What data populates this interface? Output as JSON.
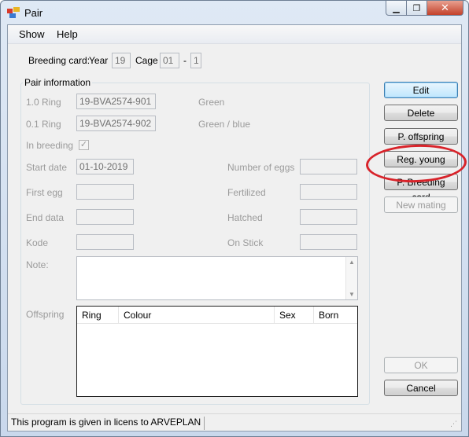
{
  "window": {
    "title": "Pair",
    "minimize_glyph": "▁",
    "maximize_glyph": "❐",
    "close_glyph": "✕"
  },
  "menu": {
    "items": [
      "Show",
      "Help"
    ]
  },
  "breeding_card": {
    "label": "Breeding card:",
    "year_label": "Year",
    "year_value": "19",
    "cage_label": "Cage",
    "cage_value": "01",
    "separator": "-",
    "cage_sub_value": "1"
  },
  "pair_info": {
    "group_title": "Pair information",
    "ring_10_label": "1.0 Ring",
    "ring_10_value": "19-BVA2574-901",
    "ring_10_colour": "Green",
    "ring_01_label": "0.1 Ring",
    "ring_01_value": "19-BVA2574-902",
    "ring_01_colour": "Green / blue",
    "in_breeding_label": "In breeding",
    "in_breeding_checked": true,
    "in_breeding_mark": "✓",
    "start_date_label": "Start date",
    "start_date_value": "01-10-2019",
    "first_egg_label": "First egg",
    "first_egg_value": "",
    "end_data_label": "End data",
    "end_data_value": "",
    "kode_label": "Kode",
    "kode_value": "",
    "number_of_eggs_label": "Number of eggs",
    "number_of_eggs_value": "",
    "fertilized_label": "Fertilized",
    "fertilized_value": "",
    "hatched_label": "Hatched",
    "hatched_value": "",
    "on_stick_label": "On Stick",
    "on_stick_value": "",
    "note_label": "Note:",
    "note_value": "",
    "offspring_label": "Offspring",
    "offspring_columns": [
      "Ring",
      "Colour",
      "Sex",
      "Born"
    ],
    "offspring_rows": []
  },
  "buttons": {
    "edit": "Edit",
    "delete": "Delete",
    "p_offspring": "P. offspring",
    "reg_young": "Reg. young",
    "p_breeding_card": "P. Breeding card",
    "new_mating": "New mating",
    "ok": "OK",
    "cancel": "Cancel"
  },
  "status": {
    "text": "This program is given in licens to ARVEPLAN"
  },
  "colors": {
    "annotation": "#d8232a",
    "accent": "#3c7fb1"
  }
}
